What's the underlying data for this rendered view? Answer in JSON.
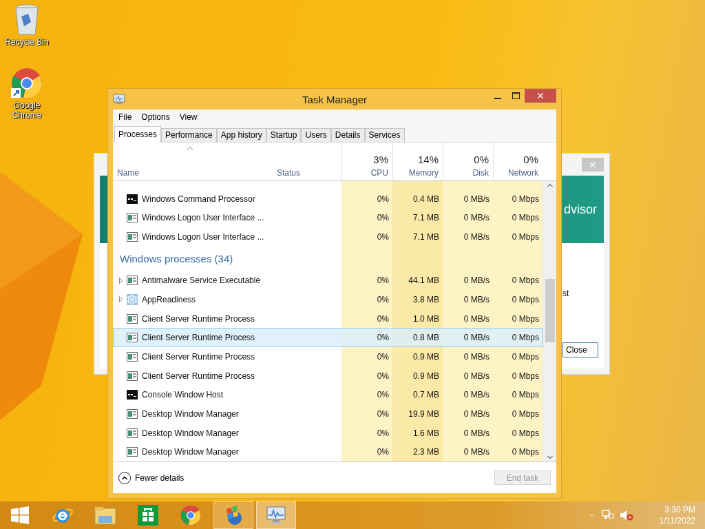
{
  "desktop_icons": [
    {
      "label": "Recycle Bin",
      "kind": "recycle"
    },
    {
      "label": "Google Chrome",
      "kind": "chrome"
    }
  ],
  "background_window": {
    "banner_text": "dvisor",
    "body_text": "st",
    "button": "Close"
  },
  "task_manager": {
    "title": "Task Manager",
    "menu": [
      "File",
      "Options",
      "View"
    ],
    "tabs": [
      {
        "label": "Processes",
        "selected": true
      },
      {
        "label": "Performance",
        "selected": false
      },
      {
        "label": "App history",
        "selected": false
      },
      {
        "label": "Startup",
        "selected": false
      },
      {
        "label": "Users",
        "selected": false
      },
      {
        "label": "Details",
        "selected": false
      },
      {
        "label": "Services",
        "selected": false
      }
    ],
    "columns": [
      {
        "label": "Name",
        "sorted": true
      },
      {
        "label": "Status",
        "sorted": false
      },
      {
        "label": "CPU",
        "total": "3%",
        "sorted": false
      },
      {
        "label": "Memory",
        "total": "14%",
        "sorted": false
      },
      {
        "label": "Disk",
        "total": "0%",
        "sorted": false
      },
      {
        "label": "Network",
        "total": "0%",
        "sorted": false
      }
    ],
    "rows": [
      {
        "kind": "console",
        "name": "Windows Command Processor",
        "expandable": false,
        "selected": false,
        "cpu": "0%",
        "memory": "0.4 MB",
        "disk": "0 MB/s",
        "network": "0 Mbps"
      },
      {
        "kind": "window",
        "name": "Windows Logon User Interface ...",
        "expandable": false,
        "selected": false,
        "cpu": "0%",
        "memory": "7.1 MB",
        "disk": "0 MB/s",
        "network": "0 Mbps"
      },
      {
        "kind": "window",
        "name": "Windows Logon User Interface ...",
        "expandable": false,
        "selected": false,
        "cpu": "0%",
        "memory": "7.1 MB",
        "disk": "0 MB/s",
        "network": "0 Mbps"
      },
      {
        "kind": "group",
        "name": "Windows processes (34)"
      },
      {
        "kind": "window",
        "name": "Antimalware Service Executable",
        "expandable": true,
        "selected": false,
        "cpu": "0%",
        "memory": "44.1 MB",
        "disk": "0 MB/s",
        "network": "0 Mbps"
      },
      {
        "kind": "gear",
        "name": "AppReadiness",
        "expandable": true,
        "selected": false,
        "cpu": "0%",
        "memory": "3.8 MB",
        "disk": "0 MB/s",
        "network": "0 Mbps"
      },
      {
        "kind": "window",
        "name": "Client Server Runtime Process",
        "expandable": false,
        "selected": false,
        "cpu": "0%",
        "memory": "1.0 MB",
        "disk": "0 MB/s",
        "network": "0 Mbps"
      },
      {
        "kind": "window",
        "name": "Client Server Runtime Process",
        "expandable": false,
        "selected": true,
        "cpu": "0%",
        "memory": "0.8 MB",
        "disk": "0 MB/s",
        "network": "0 Mbps"
      },
      {
        "kind": "window",
        "name": "Client Server Runtime Process",
        "expandable": false,
        "selected": false,
        "cpu": "0%",
        "memory": "0.9 MB",
        "disk": "0 MB/s",
        "network": "0 Mbps"
      },
      {
        "kind": "window",
        "name": "Client Server Runtime Process",
        "expandable": false,
        "selected": false,
        "cpu": "0%",
        "memory": "0.9 MB",
        "disk": "0 MB/s",
        "network": "0 Mbps"
      },
      {
        "kind": "console",
        "name": "Console Window Host",
        "expandable": false,
        "selected": false,
        "cpu": "0%",
        "memory": "0.7 MB",
        "disk": "0 MB/s",
        "network": "0 Mbps"
      },
      {
        "kind": "window",
        "name": "Desktop Window Manager",
        "expandable": false,
        "selected": false,
        "cpu": "0%",
        "memory": "19.9 MB",
        "disk": "0 MB/s",
        "network": "0 Mbps"
      },
      {
        "kind": "window",
        "name": "Desktop Window Manager",
        "expandable": false,
        "selected": false,
        "cpu": "0%",
        "memory": "1.6 MB",
        "disk": "0 MB/s",
        "network": "0 Mbps"
      },
      {
        "kind": "window",
        "name": "Desktop Window Manager",
        "expandable": false,
        "selected": false,
        "cpu": "0%",
        "memory": "2.3 MB",
        "disk": "0 MB/s",
        "network": "0 Mbps"
      }
    ],
    "footer": {
      "toggle": "Fewer details",
      "button": "End task",
      "button_disabled": true
    }
  },
  "taskbar": {
    "items": [
      {
        "kind": "start",
        "running": false,
        "selected": false
      },
      {
        "kind": "ie",
        "running": false,
        "selected": false
      },
      {
        "kind": "explorer",
        "running": false,
        "selected": false
      },
      {
        "kind": "store",
        "running": false,
        "selected": false
      },
      {
        "kind": "chrome",
        "running": false,
        "selected": false
      },
      {
        "kind": "globe",
        "running": true,
        "selected": false
      },
      {
        "kind": "monitor",
        "running": true,
        "selected": true
      }
    ],
    "time": "3:30 PM",
    "date": "1/11/2022"
  }
}
